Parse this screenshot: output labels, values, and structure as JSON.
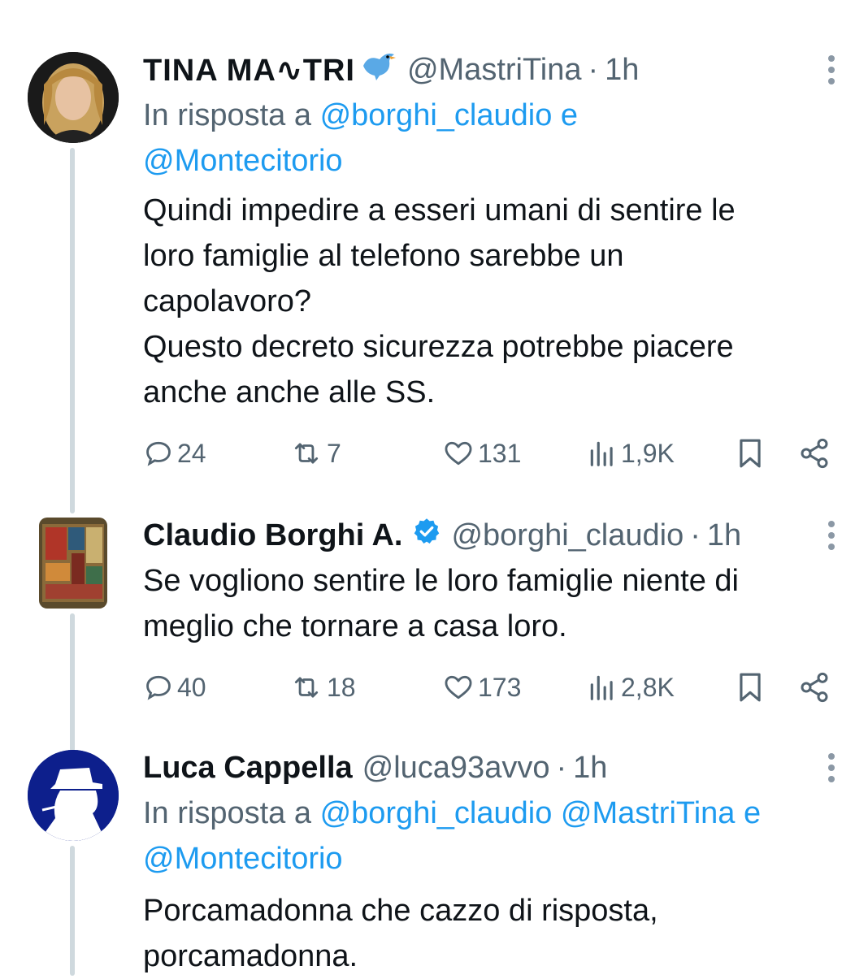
{
  "tweets": [
    {
      "name": "TINA MA∿TRI",
      "handle": "@MastriTina",
      "dot": "·",
      "time": "1h",
      "reply_prefix": "In risposta a",
      "reply_links": [
        "@borghi_claudio",
        "@Montecitorio"
      ],
      "reply_conj": "e",
      "text": "Quindi impedire a esseri umani di sentire le\nloro famiglie al telefono sarebbe un\ncapolavoro?\nQuesto decreto sicurezza potrebbe piacere\nanche anche alle  SS.",
      "replies": "24",
      "retweets": "7",
      "likes": "131",
      "views": "1,9K",
      "avatar_icon": "woman-portrait"
    },
    {
      "name": "Claudio Borghi A.",
      "handle": "@borghi_claudio",
      "dot": "·",
      "time": "1h",
      "text": "Se vogliono sentire le loro famiglie niente di\nmeglio che tornare a casa loro.",
      "replies": "40",
      "retweets": "18",
      "likes": "173",
      "views": "2,8K",
      "avatar_icon": "abstract-painting",
      "verified_icon": "verified-badge"
    },
    {
      "name": "Luca Cappella",
      "handle": "@luca93avvo",
      "dot": "·",
      "time": "1h",
      "reply_prefix": "In risposta a",
      "reply_links": [
        "@borghi_claudio",
        "@MastriTina",
        "@Montecitorio"
      ],
      "reply_conj": "e",
      "text": "Porcamadonna che cazzo di risposta,\nporcamadonna.",
      "avatar_icon": "hat-silhouette"
    }
  ],
  "colors": {
    "link": "#1d9bf0",
    "secondary": "#536471",
    "primary": "#0f1419",
    "thread_line": "#cfd9de",
    "verified": "#1d9bf0"
  },
  "icons": [
    "reply-icon",
    "retweet-icon",
    "like-icon",
    "views-icon",
    "bookmark-icon",
    "share-icon",
    "more-icon",
    "bird-icon"
  ]
}
